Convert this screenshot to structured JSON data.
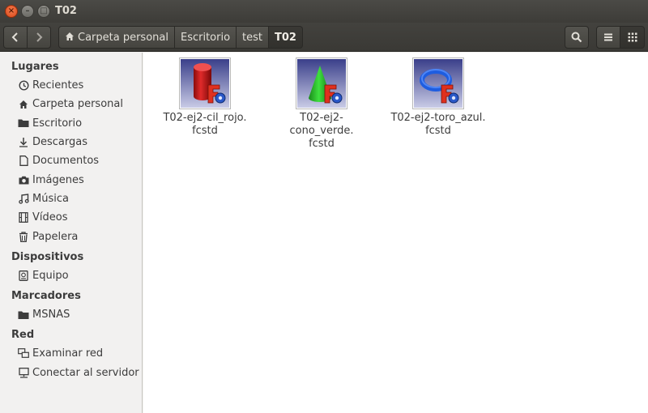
{
  "window": {
    "title": "T02",
    "close_glyph": "×",
    "minimize_glyph": "–",
    "maximize_glyph": "□"
  },
  "toolbar": {
    "back_icon": "chevron-left-icon",
    "forward_icon": "chevron-right-icon",
    "breadcrumbs": [
      {
        "label": "Carpeta personal",
        "icon": "home-icon"
      },
      {
        "label": "Escritorio"
      },
      {
        "label": "test"
      },
      {
        "label": "T02",
        "active": true
      }
    ],
    "search_icon": "search-icon",
    "list_view_icon": "list-view-icon",
    "grid_view_icon": "grid-view-icon"
  },
  "sidebar": {
    "sections": [
      {
        "title": "Lugares",
        "items": [
          {
            "label": "Recientes",
            "icon": "clock-icon"
          },
          {
            "label": "Carpeta personal",
            "icon": "home-icon"
          },
          {
            "label": "Escritorio",
            "icon": "folder-icon"
          },
          {
            "label": "Descargas",
            "icon": "download-icon"
          },
          {
            "label": "Documentos",
            "icon": "document-icon"
          },
          {
            "label": "Imágenes",
            "icon": "camera-icon"
          },
          {
            "label": "Música",
            "icon": "music-icon"
          },
          {
            "label": "Vídeos",
            "icon": "film-icon"
          },
          {
            "label": "Papelera",
            "icon": "trash-icon"
          }
        ]
      },
      {
        "title": "Dispositivos",
        "items": [
          {
            "label": "Equipo",
            "icon": "drive-icon"
          }
        ]
      },
      {
        "title": "Marcadores",
        "items": [
          {
            "label": "MSNAS",
            "icon": "folder-icon"
          }
        ]
      },
      {
        "title": "Red",
        "items": [
          {
            "label": "Examinar red",
            "icon": "network-icon"
          },
          {
            "label": "Conectar al servidor",
            "icon": "server-icon"
          }
        ]
      }
    ]
  },
  "files": [
    {
      "name_line1": "T02-ej2-cil_rojo.",
      "name_line2": "fcstd",
      "thumb": "red-cylinder-icon",
      "color": "#d42020"
    },
    {
      "name_line1": "T02-ej2-cono_verde.",
      "name_line2": "fcstd",
      "thumb": "green-cone-icon",
      "color": "#22c422"
    },
    {
      "name_line1": "T02-ej2-toro_azul.",
      "name_line2": "fcstd",
      "thumb": "blue-torus-icon",
      "color": "#1e5de0"
    }
  ],
  "colors": {
    "titlebar": "#3d3c38",
    "close_button": "#e2561f",
    "content_background": "#ffffff",
    "sidebar_background": "#f2f1f0"
  }
}
